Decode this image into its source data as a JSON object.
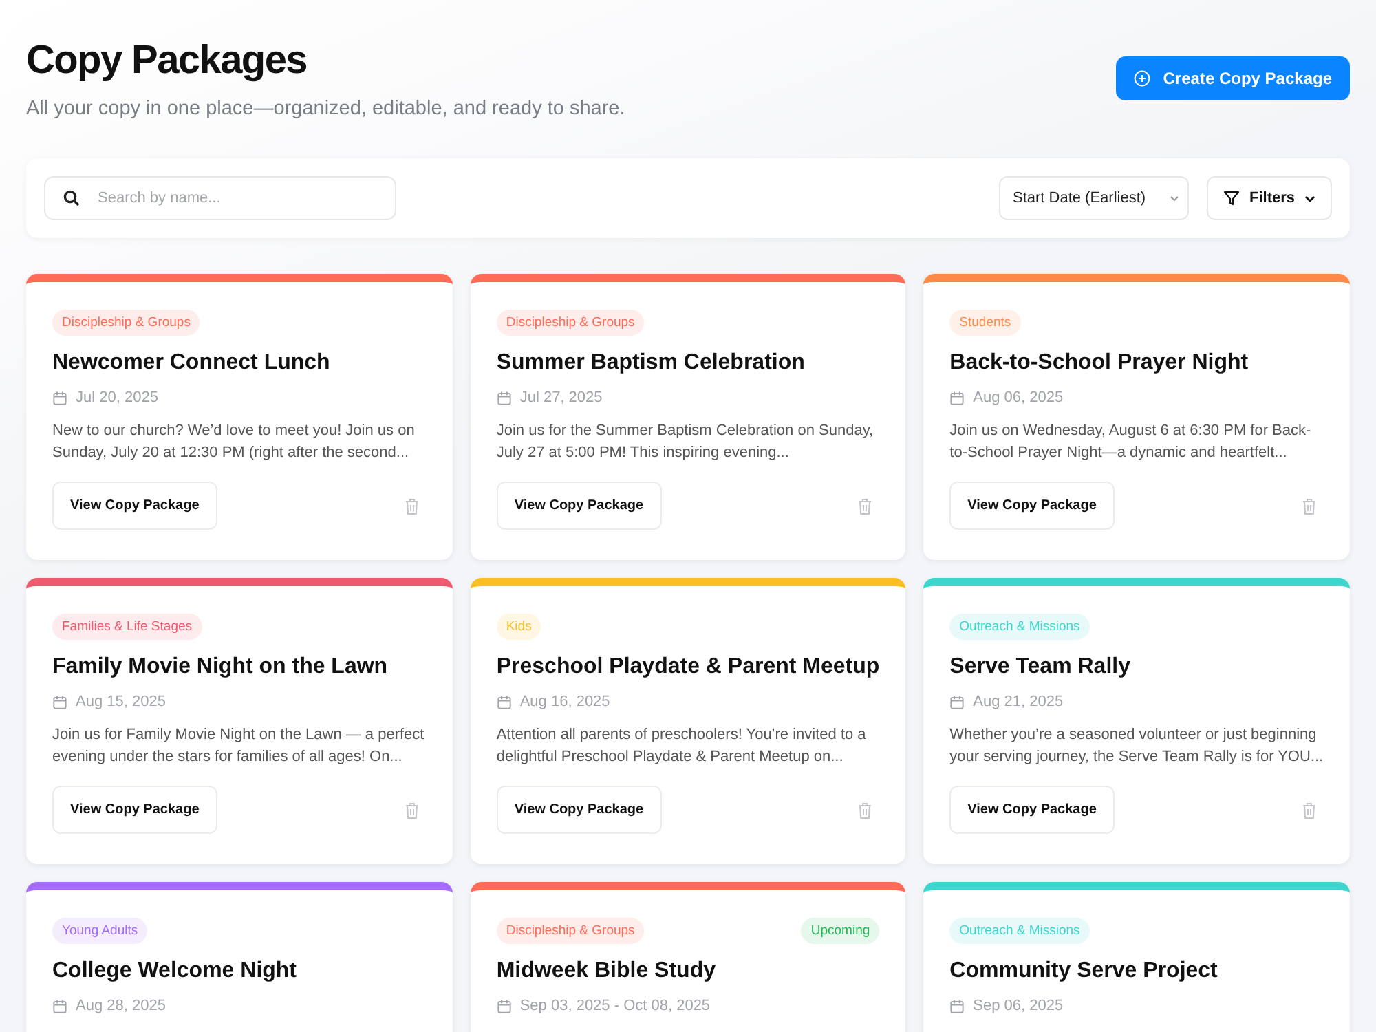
{
  "header": {
    "title": "Copy Packages",
    "subtitle": "All your copy in one place—organized, editable, and ready to share.",
    "create_button": "Create Copy Package"
  },
  "toolbar": {
    "search": {
      "placeholder": "Search by name..."
    },
    "sort": "Start Date (Earliest)",
    "filters_button": "Filters"
  },
  "cards": [
    {
      "color": "#ff6b57",
      "tag": "Discipleship & Groups",
      "title": "Newcomer Connect Lunch",
      "date": "Jul 20, 2025",
      "description": "New to our church? We’d love to meet you! Join us on Sunday, July 20 at 12:30 PM (right after the second...",
      "button": "View Copy Package"
    },
    {
      "color": "#ff6b57",
      "tag": "Discipleship & Groups",
      "title": "Summer Baptism Celebration",
      "date": "Jul 27, 2025",
      "description": "Join us for the Summer Baptism Celebration on Sunday, July 27 at 5:00 PM! This inspiring evening...",
      "button": "View Copy Package"
    },
    {
      "color": "#ff8a47",
      "tag": "Students",
      "title": "Back-to-School Prayer Night",
      "date": "Aug 06, 2025",
      "description": "Join us on Wednesday, August 6 at 6:30 PM for Back-to-School Prayer Night—a dynamic and heartfelt...",
      "button": "View Copy Package"
    },
    {
      "color": "#f05a6e",
      "tag": "Families & Life Stages",
      "title": "Family Movie Night on the Lawn",
      "date": "Aug 15, 2025",
      "description": "Join us for Family Movie Night on the Lawn — a perfect evening under the stars for families of all ages! On...",
      "button": "View Copy Package"
    },
    {
      "color": "#fbbf24",
      "tag": "Kids",
      "title": "Preschool Playdate & Parent Meetup",
      "date": "Aug 16, 2025",
      "description": "Attention all parents of preschoolers! You’re invited to a delightful Preschool Playdate & Parent Meetup on...",
      "button": "View Copy Package"
    },
    {
      "color": "#3dd6cc",
      "tag": "Outreach & Missions",
      "title": "Serve Team Rally",
      "date": "Aug 21, 2025",
      "description": "Whether you’re a seasoned volunteer or just beginning your serving journey, the Serve Team Rally is for YOU...",
      "button": "View Copy Package"
    },
    {
      "color": "#a56bfa",
      "tag": "Young Adults",
      "title": "College Welcome Night",
      "date": "Aug 28, 2025"
    },
    {
      "color": "#ff6b57",
      "tag": "Discipleship & Groups",
      "status": "Upcoming",
      "title": "Midweek Bible Study",
      "date": "Sep 03, 2025 - Oct 08, 2025"
    },
    {
      "color": "#3dd6cc",
      "tag": "Outreach & Missions",
      "title": "Community Serve Project",
      "date": "Sep 06, 2025"
    }
  ]
}
